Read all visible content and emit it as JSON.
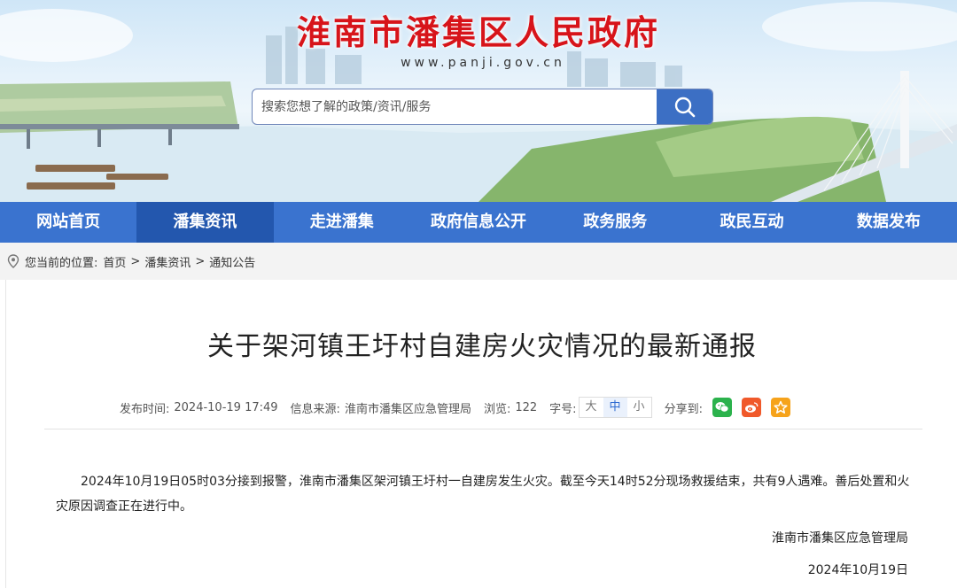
{
  "header": {
    "site_title": "淮南市潘集区人民政府",
    "site_url": "www.panji.gov.cn",
    "search": {
      "placeholder": "搜索您想了解的政策/资讯/服务"
    }
  },
  "nav": {
    "items": [
      {
        "label": "网站首页"
      },
      {
        "label": "潘集资讯",
        "active": true
      },
      {
        "label": "走进潘集"
      },
      {
        "label": "政府信息公开"
      },
      {
        "label": "政务服务"
      },
      {
        "label": "政民互动"
      },
      {
        "label": "数据发布"
      }
    ]
  },
  "breadcrumb": {
    "prefix": "您当前的位置:",
    "items": [
      "首页",
      "潘集资讯",
      "通知公告"
    ],
    "separator": ">"
  },
  "article": {
    "title": "关于架河镇王圩村自建房火灾情况的最新通报",
    "meta": {
      "publish_label": "发布时间:",
      "publish_time": "2024-10-19 17:49",
      "source_label": "信息来源:",
      "source": "淮南市潘集区应急管理局",
      "views_label": "浏览:",
      "views": "122",
      "font_label": "字号:",
      "font_sizes": [
        "大",
        "中",
        "小"
      ],
      "share_label": "分享到:",
      "share_icons": [
        "wechat-icon",
        "weibo-icon",
        "favorite-star-icon"
      ]
    },
    "paragraphs": [
      "2024年10月19日05时03分接到报警，淮南市潘集区架河镇王圩村一自建房发生火灾。截至今天14时52分现场救援结束，共有9人遇难。善后处置和火灾原因调查正在进行中。"
    ],
    "signature": "淮南市潘集区应急管理局",
    "date": "2024年10月19日"
  },
  "colors": {
    "title_red": "#d7141a",
    "nav_blue": "#3a73cf",
    "nav_active": "#2357ae",
    "wechat_green": "#2bb24c",
    "weibo_orange": "#f0592a",
    "star_orange": "#f6a31b"
  }
}
